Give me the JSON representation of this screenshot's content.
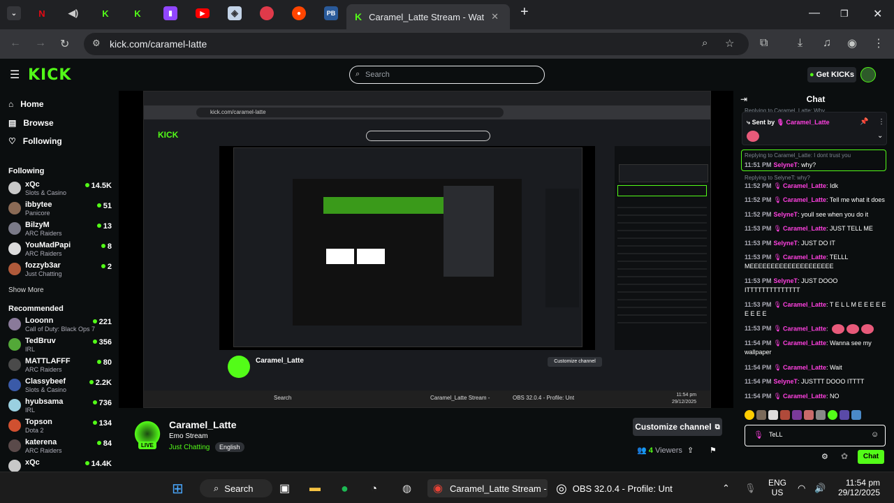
{
  "browser": {
    "active_tab_title": "Caramel_Latte Stream - Watch",
    "url": "kick.com/caramel-latte",
    "tab_icons": [
      "chevron-down-icon",
      "netflix-icon",
      "audio-icon",
      "kick-icon",
      "kick-icon",
      "twitch-icon",
      "youtube-icon",
      "shield-icon",
      "palette-icon",
      "reddit-icon",
      "pb-icon"
    ]
  },
  "header": {
    "logo": "KICK",
    "search_placeholder": "Search",
    "get_kicks": "Get KICKs"
  },
  "sidebar": {
    "nav": [
      {
        "label": "Home",
        "icon": "home-icon"
      },
      {
        "label": "Browse",
        "icon": "browse-icon"
      },
      {
        "label": "Following",
        "icon": "heart-icon"
      }
    ],
    "following_title": "Following",
    "following": [
      {
        "name": "xQc",
        "category": "Slots & Casino",
        "viewers": "14.5K",
        "color": "#c8c8c8"
      },
      {
        "name": "ibbytee",
        "category": "Panicore",
        "viewers": "51",
        "color": "#8a6a55"
      },
      {
        "name": "BilzyM",
        "category": "ARC Raiders",
        "viewers": "13",
        "color": "#7a7a88"
      },
      {
        "name": "YouMadPapi",
        "category": "ARC Raiders",
        "viewers": "8",
        "color": "#dcdcdc"
      },
      {
        "name": "fozzyb3ar",
        "category": "Just Chatting",
        "viewers": "2",
        "color": "#b05a3a"
      }
    ],
    "show_more": "Show More",
    "recommended_title": "Recommended",
    "recommended": [
      {
        "name": "Looonn",
        "category": "Call of Duty: Black Ops 7",
        "viewers": "221",
        "color": "#8a7a9a"
      },
      {
        "name": "TedBruv",
        "category": "IRL",
        "viewers": "356",
        "color": "#53a838"
      },
      {
        "name": "MATTLAFFF",
        "category": "ARC Raiders",
        "viewers": "80",
        "color": "#4a4a4a"
      },
      {
        "name": "Classybeef",
        "category": "Slots & Casino",
        "viewers": "2.2K",
        "color": "#3a5aa8"
      },
      {
        "name": "hyubsama",
        "category": "IRL",
        "viewers": "736",
        "color": "#9ad0e0"
      },
      {
        "name": "Topson",
        "category": "Dota 2",
        "viewers": "134",
        "color": "#d05030"
      },
      {
        "name": "katerena",
        "category": "ARC Raiders",
        "viewers": "84",
        "color": "#5a4a4a"
      },
      {
        "name": "xQc",
        "category": "",
        "viewers": "14.4K",
        "color": "#c8c8c8"
      }
    ]
  },
  "stream": {
    "streamer": "Caramel_Latte",
    "title": "Emo Stream",
    "category": "Just Chatting",
    "tag": "English",
    "live": "LIVE",
    "customize": "Customize channel",
    "viewers_count": "4",
    "viewers_label": "Viewers"
  },
  "chat": {
    "title": "Chat",
    "top_reply": "Replying to Caramel_Latte: Why",
    "pinned_label": "Sent by",
    "pinned_user": "Caramel_Latte",
    "reply1": "Replying to Caramel_Latte: I dont trust you",
    "reply2": "Replying to SelyneT: why?",
    "messages": [
      {
        "time": "11:51 PM",
        "user": "SelyneT",
        "color": "#ff40e0",
        "text": "why?",
        "mic": false
      },
      {
        "time": "11:52 PM",
        "user": "Caramel_Latte",
        "color": "#ff40e0",
        "text": "Idk",
        "mic": true
      },
      {
        "time": "11:52 PM",
        "user": "Caramel_Latte",
        "color": "#ff40e0",
        "text": "Tell me what it does",
        "mic": true
      },
      {
        "time": "11:52 PM",
        "user": "SelyneT",
        "color": "#ff40e0",
        "text": "youll see when you do it",
        "mic": false
      },
      {
        "time": "11:53 PM",
        "user": "Caramel_Latte",
        "color": "#ff40e0",
        "text": "JUST TELL ME",
        "mic": true
      },
      {
        "time": "11:53 PM",
        "user": "SelyneT",
        "color": "#ff40e0",
        "text": "JUST DO IT",
        "mic": false
      },
      {
        "time": "11:53 PM",
        "user": "Caramel_Latte",
        "color": "#ff40e0",
        "text": "TELLL MEEEEEEEEEEEEEEEEEEEE",
        "mic": true
      },
      {
        "time": "11:53 PM",
        "user": "SelyneT",
        "color": "#ff40e0",
        "text": "JUST DOOO ITTTTTTTTTTTTTT",
        "mic": false
      },
      {
        "time": "11:53 PM",
        "user": "Caramel_Latte",
        "color": "#ff40e0",
        "text": "T E L L M E E E E E E E E E",
        "mic": true
      },
      {
        "time": "11:53 PM",
        "user": "Caramel_Latte",
        "color": "#ff40e0",
        "text": "",
        "mic": true
      },
      {
        "time": "11:54 PM",
        "user": "Caramel_Latte",
        "color": "#ff40e0",
        "text": "Wanna see my wallpaper",
        "mic": true
      },
      {
        "time": "11:54 PM",
        "user": "Caramel_Latte",
        "color": "#ff40e0",
        "text": "Wait",
        "mic": true
      },
      {
        "time": "11:54 PM",
        "user": "SelyneT",
        "color": "#ff40e0",
        "text": "JUSTTT DOOO ITTTT",
        "mic": false
      },
      {
        "time": "11:54 PM",
        "user": "Caramel_Latte",
        "color": "#ff40e0",
        "text": "NO",
        "mic": true
      }
    ],
    "input_value": "TeLL",
    "send": "Chat"
  },
  "taskbar": {
    "search": "Search",
    "chrome_title": "Caramel_Latte Stream -",
    "obs_title": "OBS 32.0.4 - Profile: Unt",
    "lang1": "ENG",
    "lang2": "US",
    "time": "11:54 pm",
    "date": "29/12/2025"
  },
  "colors": {
    "accent": "#53fc18",
    "bg": "#0b0e0f"
  }
}
